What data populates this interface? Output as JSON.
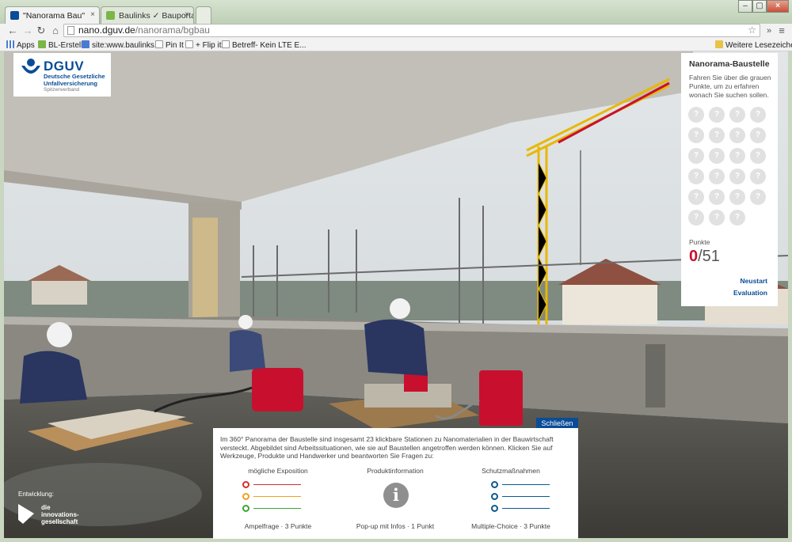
{
  "browser": {
    "tabs": [
      {
        "title": "\"Nanorama Bau\"",
        "active": true
      },
      {
        "title": "Baulinks ✓ Bauportal fü",
        "active": false
      }
    ],
    "url_host": "nano.dguv.de",
    "url_path": "/nanorama/bgbau",
    "bookmarks": [
      {
        "label": "Apps",
        "icon": "apps-grid-icon"
      },
      {
        "label": "BL-Erstell.",
        "icon": "baulinks-favicon"
      },
      {
        "label": "site:www.baulinks....",
        "icon": "google-icon"
      },
      {
        "label": "Pin It",
        "icon": "page-icon"
      },
      {
        "label": "+ Flip it",
        "icon": "page-icon"
      },
      {
        "label": "Betreff- Kein LTE E...",
        "icon": "page-icon"
      }
    ],
    "other_bookmarks": "Weitere Lesezeichen",
    "accent": "#0a4c97"
  },
  "logo": {
    "name": "DGUV",
    "lines": [
      "Deutsche Gesetzliche",
      "Unfallversicherung"
    ],
    "sub": "Spitzenverband"
  },
  "panel": {
    "title": "Nanorama-Baustelle",
    "description": "Fahren Sie über die grauen Punkte, um zu erfahren wonach Sie suchen sollen.",
    "station_marker": "?",
    "station_count": 23,
    "points_label": "Punkte",
    "points_current": "0",
    "points_total": "/51",
    "restart": "Neustart",
    "evaluation": "Evaluation"
  },
  "infobox": {
    "close": "Schließen",
    "intro": "Im 360° Panorama der Baustelle sind insgesamt 23 klickbare Stationen zu Nanomaterialien in der Bauwirtschaft versteckt. Abgebildet sind Arbeitssituationen, wie sie auf Baustellen angetroffen werden können. Klicken Sie auf Werkzeuge, Produkte und Handwerker und beantworten Sie Fragen zu:",
    "columns": [
      {
        "title": "mögliche Exposition",
        "footer": "Ampelfrage · 3 Punkte",
        "colors": [
          "#d32f2f",
          "#f0a020",
          "#3aa635"
        ]
      },
      {
        "title": "Produktinformation",
        "footer": "Pop-up mit Infos · 1 Punkt",
        "icon": "info-icon",
        "icon_char": "i"
      },
      {
        "title": "Schutzmaßnahmen",
        "footer": "Multiple-Choice · 3 Punkte",
        "colors": [
          "#0a5a8f",
          "#0a5a8f",
          "#0a5a8f"
        ]
      }
    ]
  },
  "credit": {
    "label": "Entwicklung:",
    "name_lines": [
      "die",
      "innovations-",
      "gesellschaft"
    ]
  }
}
